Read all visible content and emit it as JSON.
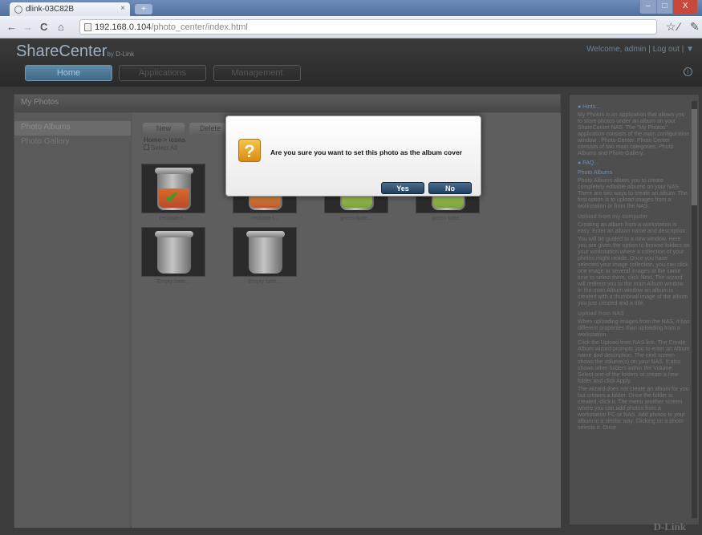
{
  "browser": {
    "tab_title": "dlink-03C82B",
    "tab_close": "×",
    "url_host": "192.168.0.104",
    "url_path": "/photo_center/index.html",
    "nav_back": "←",
    "nav_forward": "→",
    "nav_reload": "C",
    "nav_home": "⌂",
    "star": "☆",
    "window_min": "–",
    "window_max": "□",
    "window_close": "X"
  },
  "app": {
    "brand": "ShareCenter",
    "brand_by": "by D-Link",
    "welcome": "Welcome, admin | Log out | ▼",
    "tabs": {
      "home": "Home",
      "applications": "Applications",
      "management": "Management"
    },
    "panel_title": "My Photos",
    "sidebar": [
      "Photo Albums",
      "Photo Gallery"
    ],
    "toolbar": {
      "new": "New",
      "delete": "Delete"
    },
    "breadcrumb": "Home > icons",
    "select_all": "Select All",
    "photos": [
      {
        "caption": "recloste-i...",
        "liquid": "#b94b2a"
      },
      {
        "caption": "recloste-i...",
        "liquid": "#c0562e"
      },
      {
        "caption": "green-bate...",
        "liquid": "#7aa33b"
      },
      {
        "caption": "green-bate...",
        "liquid": "#7aa33b"
      },
      {
        "caption": "Empty bate...",
        "liquid": "none"
      },
      {
        "caption": "Empty bate...",
        "liquid": "none"
      }
    ],
    "footer_brand": "D-Link"
  },
  "help": {
    "sections": [
      {
        "type": "h",
        "text": "● Hints..."
      },
      {
        "type": "p",
        "text": "My Photos is an application that allows you to store photos under an album on your ShareCenter NAS. The \"My Photos\" application consists of the main configuration window : Photo Center. Photo Center consists of two main categories, Photo Albums and Photo Gallery."
      },
      {
        "type": "h",
        "text": "● FAQ..."
      },
      {
        "type": "h",
        "text": "Photo Albums"
      },
      {
        "type": "p",
        "text": "Photo Albums allows you to create completely editable albums on your NAS. There are two ways to create an album. The first option is to upload images from a workstation or from the NAS."
      },
      {
        "type": "s",
        "text": "Upload from my computer"
      },
      {
        "type": "p",
        "text": "Creating an album from a workstation is easy. Enter an album name and description."
      },
      {
        "type": "p",
        "text": "You will be guided to a new window. Here you are given the option to browse folders on your workstation where a collection of your photos might reside. Once you have selected your image collection, you can click one image or several images at the same time to select them, click Next. The wizard will redirect you to the main Album window. In the main Album window an album is created with a thumbnail image of the album you just created and a title."
      },
      {
        "type": "s",
        "text": "Upload from NAS"
      },
      {
        "type": "p",
        "text": "When uploading images from the NAS, it has different properties than uploading from a workstation."
      },
      {
        "type": "p",
        "text": "Click the Upload from NAS link. The Create Album wizard prompts you to enter an Album name and description. The next screen shows the volume(s) on your NAS. It also shows other folders within the Volume. Select one of the folders or create a new folder and click Apply."
      },
      {
        "type": "p",
        "text": "The wizard does not create an album for you but creates a folder. Once the folder is created, click it. The menu another screen where you can add photos from a workstation PC or NAS. Add photos to your album in a similar way. Clicking on a photo selects it. Once"
      }
    ]
  },
  "dialog": {
    "message": "Are you sure you want to set this photo as the album cover",
    "icon": "?",
    "yes": "Yes",
    "no": "No"
  }
}
